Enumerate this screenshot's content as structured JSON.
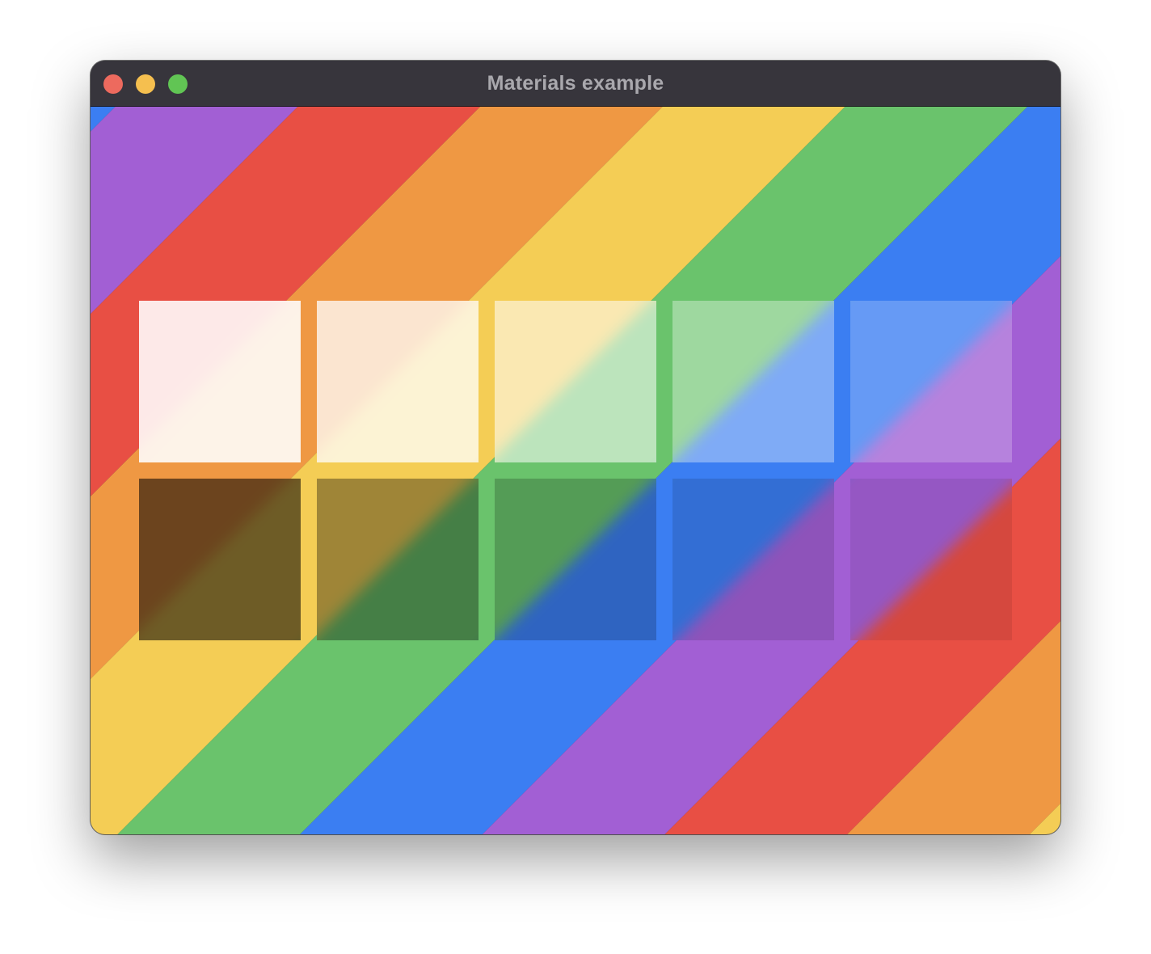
{
  "window": {
    "title": "Materials example"
  },
  "traffic_lights": {
    "close_color": "#ed6a5e",
    "minimize_color": "#f5bf4f",
    "maximize_color": "#61c554"
  },
  "background": {
    "stripe_colors": [
      "#e84f44",
      "#ef9843",
      "#f4cd55",
      "#6ac36c",
      "#3b7ef2",
      "#a25fd4"
    ]
  },
  "materials": {
    "light_tint_opacities": [
      0.88,
      0.75,
      0.55,
      0.35,
      0.22
    ],
    "dark_tint_opacities": [
      0.55,
      0.35,
      0.2,
      0.12,
      0.08
    ],
    "light_tint_color": "#ffffff",
    "dark_tint_color": "#000000"
  }
}
